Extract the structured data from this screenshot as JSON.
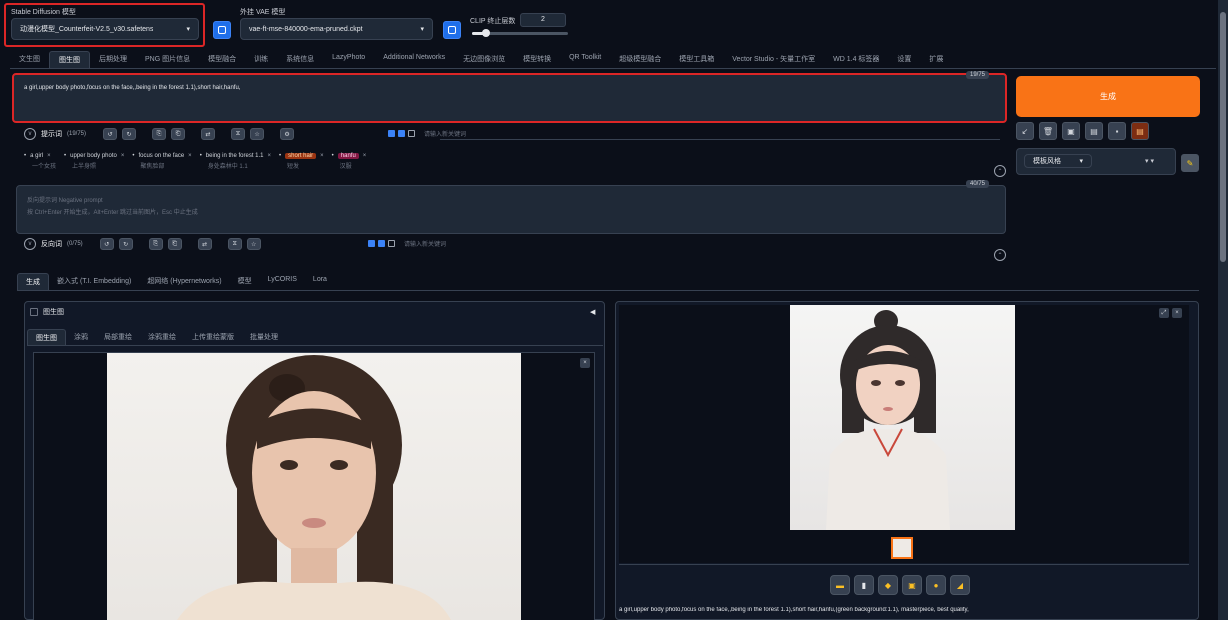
{
  "models": {
    "sd_label": "Stable Diffusion 模型",
    "sd_value": "动漫化模型_Counterfeit-V2.5_v30.safetens",
    "vae_label": "外挂 VAE 模型",
    "vae_value": "vae-ft-mse-840000-ema-pruned.ckpt",
    "clip_label": "CLIP 终止层数",
    "clip_value": "2",
    "clip_fill": 0.15
  },
  "main_tabs": [
    "文生图",
    "图生图",
    "后期处理",
    "PNG 图片信息",
    "模型融合",
    "训练",
    "系统信息",
    "LazyPhoto",
    "Additional Networks",
    "无边图像浏览",
    "模型转换",
    "QR Toolkit",
    "超级模型融合",
    "模型工具箱",
    "Vector Studio - 矢量工作室",
    "WD 1.4 标签器",
    "设置",
    "扩展"
  ],
  "active_main_tab": 1,
  "prompt": {
    "text": "a girl,upper body photo,focus on the face,,being in the forest 1.1),short hair,hanfu,",
    "counter": "19/75"
  },
  "negative": {
    "placeholder_line1": "反向提示词 Negative prompt",
    "placeholder_line2": "按 Ctrl+Enter 开始生成，Alt+Enter 跳过当前图片，Esc 中止生成",
    "counter": "40/75"
  },
  "pos_toolbar": {
    "label": "提示词",
    "count": "(19/75)",
    "search_placeholder": "请输入新关键词"
  },
  "neg_toolbar": {
    "label": "反向词",
    "count": "(0/75)",
    "search_placeholder": "请输入新关键词"
  },
  "tags": [
    {
      "en": "a girl",
      "tr": "一个女孩",
      "hl": ""
    },
    {
      "en": "upper body photo",
      "tr": "上半身照",
      "hl": ""
    },
    {
      "en": "focus on the face",
      "tr": "聚焦脸部",
      "hl": ""
    },
    {
      "en": "being in the forest 1.1",
      "tr": "身处森林中 1.1",
      "hl": ""
    },
    {
      "en": "short hair",
      "tr": "短发",
      "hl": "orange"
    },
    {
      "en": "hanfu",
      "tr": "汉服",
      "hl": "pink"
    }
  ],
  "generate_label": "生成",
  "styles_label": "模板风格",
  "section_tabs": [
    "生成",
    "嵌入式 (T.I. Embedding)",
    "超网络 (Hypernetworks)",
    "模型",
    "LyCORIS",
    "Lora"
  ],
  "active_section_tab": 0,
  "img2img": {
    "section_label": "图生图",
    "subtabs": [
      "图生图",
      "涂鸦",
      "局部重绘",
      "涂鸦重绘",
      "上传重绘蒙版",
      "批量处理"
    ],
    "active_subtab": 0
  },
  "output_caption": "a girl,upper body photo,focus on the face,,being in the forest 1.1),short hair,hanfu,(green background:1.1),  masterpiece, best quality,",
  "colors": {
    "accent": "#f97316",
    "bg": "#0b0f19",
    "highlight_frame": "#dc2626"
  },
  "icons": {
    "refresh": "refresh-icon",
    "paint": "paint-icon",
    "trash": "trash-icon",
    "folder": "folder-icon",
    "save": "save-icon",
    "zip": "zip-icon"
  }
}
